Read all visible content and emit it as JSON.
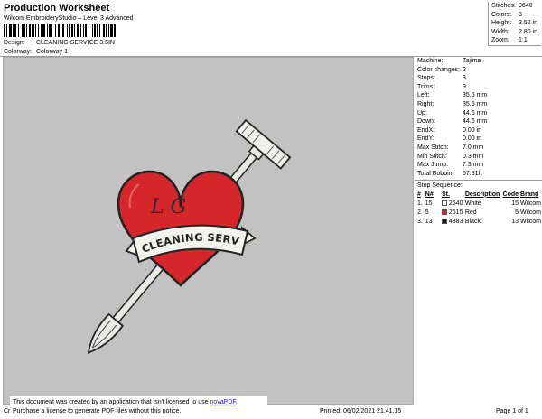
{
  "header": {
    "title": "Production Worksheet",
    "subtitle": "Wilcom EmbroideryStudio – Level 3 Advanced",
    "design_label": "Design:",
    "design_value": "CLEANING SERVICE 3.5IN",
    "colorway_label": "Colorway:",
    "colorway_value": "Colorway 1"
  },
  "summary": [
    {
      "k": "Stitches:",
      "v": "9640"
    },
    {
      "k": "Colors:",
      "v": "3"
    },
    {
      "k": "Height:",
      "v": "3.52 in"
    },
    {
      "k": "Width:",
      "v": "2.80 in"
    },
    {
      "k": "Zoom:",
      "v": "1:1"
    }
  ],
  "properties": [
    {
      "k": "Machine:",
      "v": "Tajima"
    },
    {
      "k": "Color changes:",
      "v": "2"
    },
    {
      "k": "Stops:",
      "v": "3"
    },
    {
      "k": "Trims:",
      "v": "9"
    },
    {
      "k": "Left:",
      "v": "35.5 mm"
    },
    {
      "k": "Right:",
      "v": "35.5 mm"
    },
    {
      "k": "Up:",
      "v": "44.6 mm"
    },
    {
      "k": "Down:",
      "v": "44.6 mm"
    },
    {
      "k": "EndX:",
      "v": "0.00 in"
    },
    {
      "k": "EndY:",
      "v": "0.00 in"
    },
    {
      "k": "Max Stitch:",
      "v": "7.0 mm"
    },
    {
      "k": "Min Stitch:",
      "v": "0.3 mm"
    },
    {
      "k": "Max Jump:",
      "v": "7.3 mm"
    },
    {
      "k": "Total Bobbin:",
      "v": "57.81ft"
    }
  ],
  "stop_sequence": {
    "label": "Stop Sequence:",
    "headers": [
      "#",
      "N#",
      "St.",
      "Description",
      "Code",
      "Brand"
    ],
    "rows": [
      {
        "num": "1.",
        "n": "15",
        "color": "#ffffff",
        "st": "2640",
        "desc": "White",
        "code": "15",
        "brand": "Wilcom"
      },
      {
        "num": "2.",
        "n": "5",
        "color": "#d11f25",
        "st": "2615",
        "desc": "Red",
        "code": "5",
        "brand": "Wilcom"
      },
      {
        "num": "3.",
        "n": "13",
        "color": "#1a1a1a",
        "st": "4383",
        "desc": "Black",
        "code": "13",
        "brand": "Wilcom"
      }
    ]
  },
  "design": {
    "monogram": "L G",
    "banner_text": "CLEANING SERVICE",
    "colors": {
      "red": "#d4262b",
      "white": "#f2f2ee",
      "black": "#222222",
      "background": "#c2c2c2"
    }
  },
  "notice": {
    "line1_prefix": "This document was created by an application that isn't licensed to use ",
    "link": "novaPDF",
    "line1_suffix": ".",
    "line2": "Purchase a license to generate PDF files without this notice."
  },
  "footer": {
    "left": "Cr",
    "printed": "Printed:  06/02/2021 21.41.15",
    "page": "Page 1 of 1"
  }
}
